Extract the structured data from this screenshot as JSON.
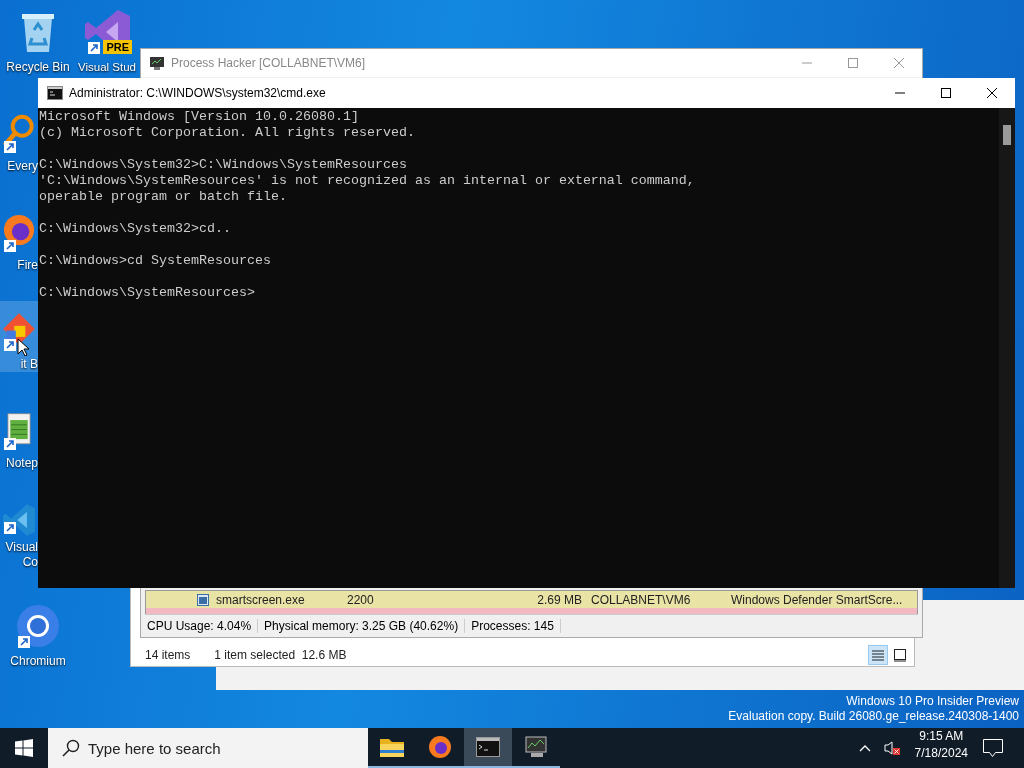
{
  "desktop": {
    "icons": [
      {
        "kind": "recycle",
        "label": "Recycle Bin",
        "shortcut": false,
        "cut": false,
        "selected": false
      },
      {
        "kind": "everything",
        "label": "Every",
        "shortcut": true,
        "cut": true,
        "selected": false
      },
      {
        "kind": "firefox",
        "label": "Fire",
        "shortcut": true,
        "cut": true,
        "selected": false
      },
      {
        "kind": "git",
        "label": "it B",
        "shortcut": true,
        "cut": true,
        "selected": true
      },
      {
        "kind": "notepad",
        "label": "Notep",
        "shortcut": true,
        "cut": true,
        "selected": false
      },
      {
        "kind": "vscode",
        "label": "Visual Co",
        "shortcut": true,
        "cut": true,
        "selected": false
      },
      {
        "kind": "chromium",
        "label": "Chromium",
        "shortcut": true,
        "cut": false,
        "selected": false
      }
    ],
    "second_column": [
      {
        "kind": "vs",
        "label": "Visual Stud",
        "badge": "PRE",
        "shortcut": true
      }
    ],
    "watermark": [
      "Windows 10 Pro Insider Preview",
      "Evaluation copy. Build 26080.ge_release.240308-1400"
    ]
  },
  "explorer": {
    "status_items": "14 items",
    "selection": "1 item selected  12.6 MB",
    "views": [
      {
        "kind": "details",
        "selected": true
      },
      {
        "kind": "tiles",
        "selected": false
      }
    ]
  },
  "process_hacker": {
    "title": "Process Hacker [COLLABNET\\VM6]",
    "rows": [
      {
        "cells": [
          "smartscreen.exe",
          "2200",
          "2.69 MB",
          "COLLABNET\\VM6",
          "Windows Defender SmartScre..."
        ],
        "color": "#e9e3a6"
      },
      {
        "cells": [],
        "color": "#f2b9c2"
      }
    ],
    "status": [
      "CPU Usage: 4.04%",
      "Physical memory: 3.25 GB (40.62%)",
      "Processes: 145"
    ]
  },
  "cmd": {
    "title": "Administrator: C:\\WINDOWS\\system32\\cmd.exe",
    "blocks": [
      [
        "Microsoft Windows [Version 10.0.26080.1]",
        "(c) Microsoft Corporation. All rights reserved."
      ],
      [
        "C:\\Windows\\System32>C:\\Windows\\SystemResources",
        "'C:\\Windows\\SystemResources' is not recognized as an internal or external command,",
        "operable program or batch file."
      ],
      [
        "C:\\Windows\\System32>cd.."
      ],
      [
        "C:\\Windows>cd SystemResources"
      ],
      [
        "C:\\Windows\\SystemResources>"
      ]
    ]
  },
  "taskbar": {
    "search": {
      "placeholder": "Type here to search"
    },
    "apps": [
      {
        "kind": "folder",
        "selected": false,
        "running": true
      },
      {
        "kind": "firefox",
        "selected": false,
        "running": true
      },
      {
        "kind": "terminal",
        "selected": true,
        "running": true
      },
      {
        "kind": "monitor",
        "selected": false,
        "running": true
      }
    ],
    "tray": {
      "muted": true
    },
    "time": "9:15 AM",
    "date": "7/18/2024"
  }
}
